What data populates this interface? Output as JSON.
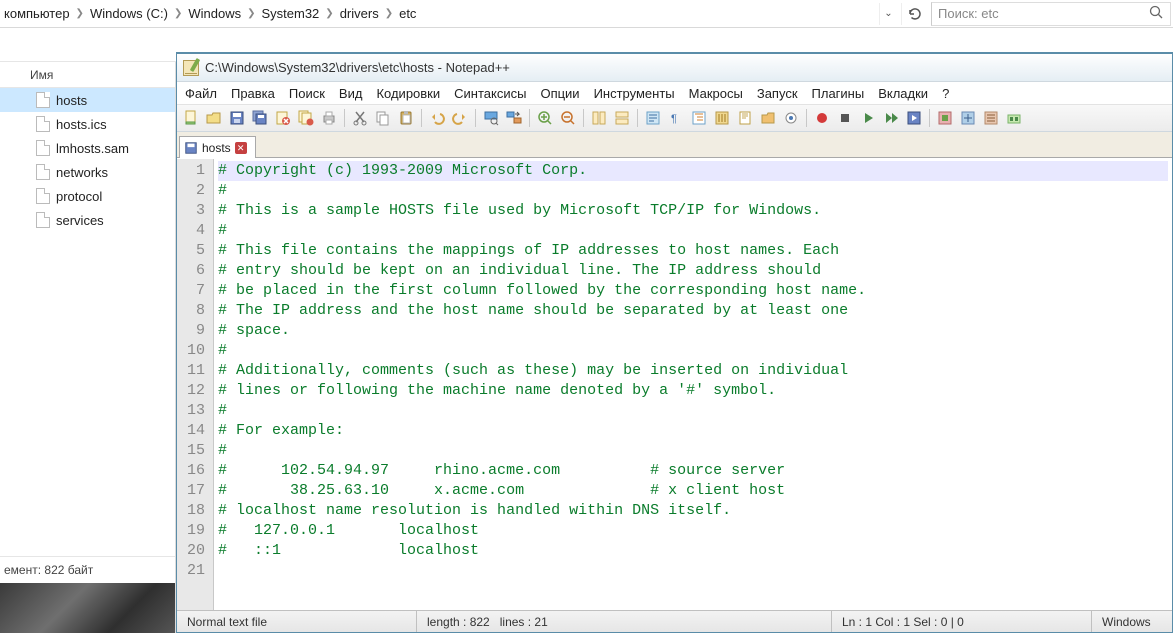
{
  "explorer": {
    "breadcrumb": [
      "компьютер",
      "Windows (C:)",
      "Windows",
      "System32",
      "drivers",
      "etc"
    ],
    "search_placeholder": "Поиск: etc",
    "column_header": "Имя",
    "files": [
      "hosts",
      "hosts.ics",
      "lmhosts.sam",
      "networks",
      "protocol",
      "services"
    ],
    "selected_index": 0,
    "status": "емент: 822 байт"
  },
  "npp": {
    "title": "C:\\Windows\\System32\\drivers\\etc\\hosts - Notepad++",
    "menu": [
      "Файл",
      "Правка",
      "Поиск",
      "Вид",
      "Кодировки",
      "Синтаксисы",
      "Опции",
      "Инструменты",
      "Макросы",
      "Запуск",
      "Плагины",
      "Вкладки",
      "?"
    ],
    "tab_label": "hosts",
    "lines": [
      "# Copyright (c) 1993-2009 Microsoft Corp.",
      "#",
      "# This is a sample HOSTS file used by Microsoft TCP/IP for Windows.",
      "#",
      "# This file contains the mappings of IP addresses to host names. Each",
      "# entry should be kept on an individual line. The IP address should",
      "# be placed in the first column followed by the corresponding host name.",
      "# The IP address and the host name should be separated by at least one",
      "# space.",
      "#",
      "# Additionally, comments (such as these) may be inserted on individual",
      "# lines or following the machine name denoted by a '#' symbol.",
      "#",
      "# For example:",
      "#",
      "#      102.54.94.97     rhino.acme.com          # source server",
      "#       38.25.63.10     x.acme.com              # x client host",
      "# localhost name resolution is handled within DNS itself.",
      "#   127.0.0.1       localhost",
      "#   ::1             localhost",
      ""
    ],
    "status": {
      "type": "Normal text file",
      "length_label": "length : 822",
      "lines_label": "lines : 21",
      "pos": "Ln : 1   Col : 1   Sel : 0 | 0",
      "encoding": "Windows"
    }
  }
}
